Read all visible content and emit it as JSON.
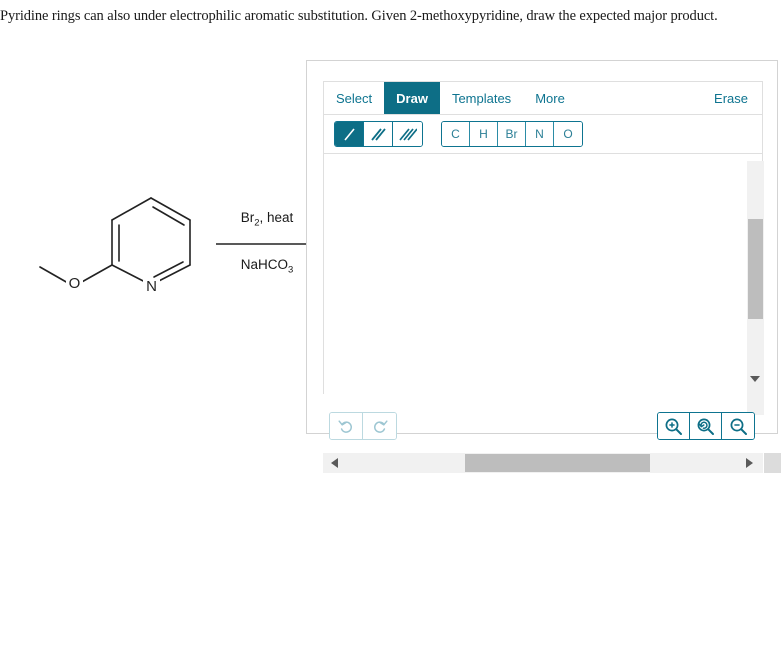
{
  "question": {
    "text": "Pyridine rings can also under electrophilic aromatic substitution. Given 2-methoxypyridine, draw the expected major product."
  },
  "reaction": {
    "reactant_name": "2-methoxypyridine",
    "reactant_labels": {
      "nitrogen": "N",
      "oxygen": "O"
    },
    "conditions_above": "Br",
    "conditions_above_sub": "2",
    "conditions_above_rest": ", heat",
    "conditions_below": "NaHCO",
    "conditions_below_sub": "3",
    "arrow": "reaction-arrow"
  },
  "editor": {
    "tabs": [
      {
        "label": "Select",
        "active": false
      },
      {
        "label": "Draw",
        "active": true
      },
      {
        "label": "Templates",
        "active": false
      },
      {
        "label": "More",
        "active": false
      }
    ],
    "erase_label": "Erase",
    "bond_tools": [
      {
        "name": "single-bond-tool",
        "icon": "single-bond-icon",
        "active": true
      },
      {
        "name": "double-bond-tool",
        "icon": "double-bond-icon",
        "active": false
      },
      {
        "name": "triple-bond-tool",
        "icon": "triple-bond-icon",
        "active": false
      }
    ],
    "elements": [
      {
        "symbol": "C"
      },
      {
        "symbol": "H"
      },
      {
        "symbol": "Br"
      },
      {
        "symbol": "N"
      },
      {
        "symbol": "O"
      }
    ],
    "history_buttons": [
      {
        "name": "undo-button",
        "icon": "undo-icon",
        "enabled": false
      },
      {
        "name": "redo-button",
        "icon": "redo-icon",
        "enabled": false
      }
    ],
    "zoom_buttons": [
      {
        "name": "zoom-in-button",
        "icon": "zoom-in-icon"
      },
      {
        "name": "zoom-reset-button",
        "icon": "zoom-reset-icon"
      },
      {
        "name": "zoom-out-button",
        "icon": "zoom-out-icon"
      }
    ],
    "canvas_empty": true
  },
  "colors": {
    "accent_teal": "#0d6e86",
    "accent_teal_light": "#0e7490",
    "disabled_teal": "#9dc6d2",
    "panel_border": "#d3d3d3",
    "scroll_track": "#f1f1f1",
    "scroll_thumb": "#bdbdbd",
    "molecule_stroke": "#222222"
  }
}
